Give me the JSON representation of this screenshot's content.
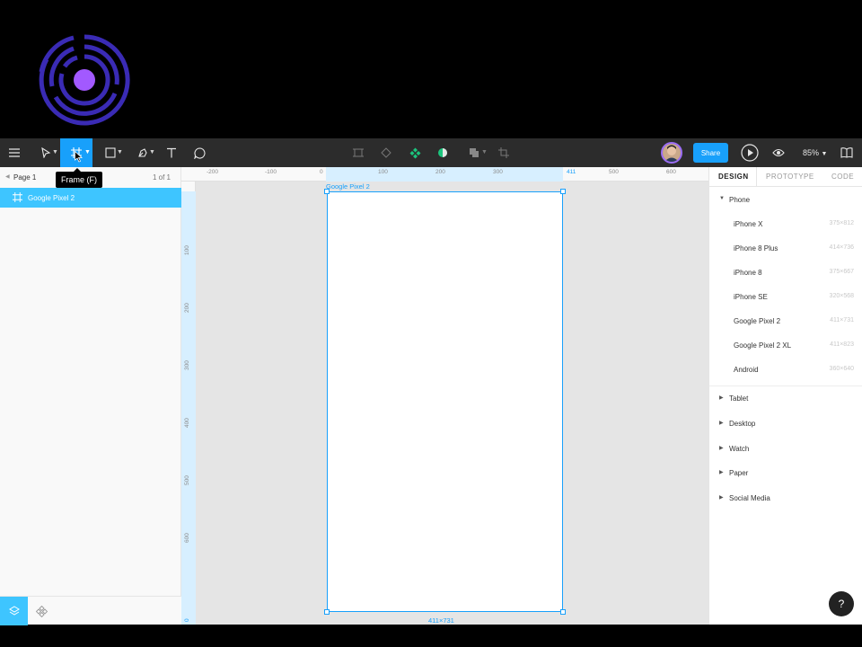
{
  "toolbar": {
    "tooltip": "Frame (F)",
    "share_label": "Share",
    "zoom": "85%"
  },
  "layers_panel": {
    "page_name": "Page 1",
    "page_count": "1 of 1",
    "layers": [
      {
        "name": "Google Pixel 2",
        "selected": true
      }
    ]
  },
  "canvas": {
    "frame_title": "Google Pixel 2",
    "frame_dims": "411×731",
    "ruler_top": [
      "-200",
      "-100",
      "0",
      "100",
      "200",
      "300",
      "411",
      "500",
      "600"
    ],
    "ruler_left": [
      "100",
      "200",
      "300",
      "400",
      "500",
      "600"
    ],
    "ruler_left_bottom": "0"
  },
  "design_panel": {
    "tabs": [
      "DESIGN",
      "PROTOTYPE",
      "CODE"
    ],
    "phone_header": "Phone",
    "phones": [
      {
        "name": "iPhone X",
        "size": "375×812"
      },
      {
        "name": "iPhone 8 Plus",
        "size": "414×736"
      },
      {
        "name": "iPhone 8",
        "size": "375×667"
      },
      {
        "name": "iPhone SE",
        "size": "320×568"
      },
      {
        "name": "Google Pixel 2",
        "size": "411×731"
      },
      {
        "name": "Google Pixel 2 XL",
        "size": "411×823"
      },
      {
        "name": "Android",
        "size": "360×640"
      }
    ],
    "categories": [
      "Tablet",
      "Desktop",
      "Watch",
      "Paper",
      "Social Media"
    ]
  },
  "help_label": "?",
  "colors": {
    "accent": "#18a0fb",
    "toolbar_bg": "#2c2c2c",
    "selected_layer": "#3ec5ff",
    "logo": "#3a2bb5",
    "logo_dot": "#a259ff"
  }
}
